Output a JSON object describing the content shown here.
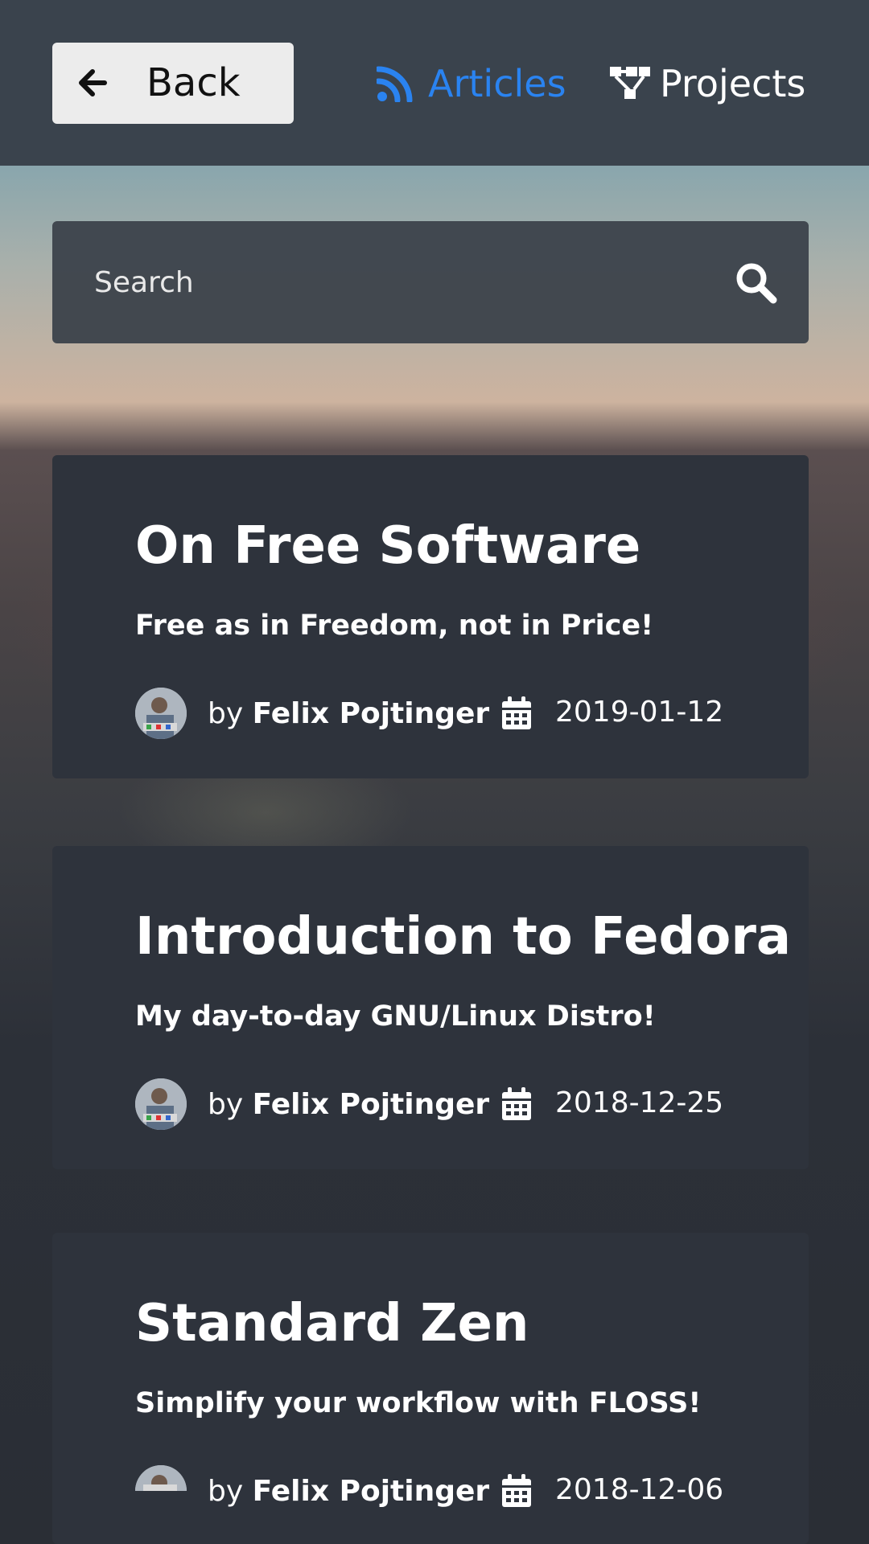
{
  "header": {
    "back_label": "Back",
    "nav": [
      {
        "label": "Articles",
        "icon": "rss-icon",
        "active": true,
        "color": "#2a83f0"
      },
      {
        "label": "Projects",
        "icon": "sitemap-icon",
        "active": false
      }
    ]
  },
  "search": {
    "placeholder": "Search",
    "value": ""
  },
  "articles": [
    {
      "title": "On Free Software",
      "subtitle": "Free as in Freedom, not in Price!",
      "by": "by",
      "author": "Felix Pojtinger",
      "date": "2019-01-12"
    },
    {
      "title": "Introduction to Fedora",
      "subtitle": "My day-to-day GNU/Linux Distro!",
      "by": "by",
      "author": "Felix Pojtinger",
      "date": "2018-12-25"
    },
    {
      "title": "Standard Zen",
      "subtitle": "Simplify your workflow with FLOSS!",
      "by": "by",
      "author": "Felix Pojtinger",
      "date": "2018-12-06"
    }
  ]
}
